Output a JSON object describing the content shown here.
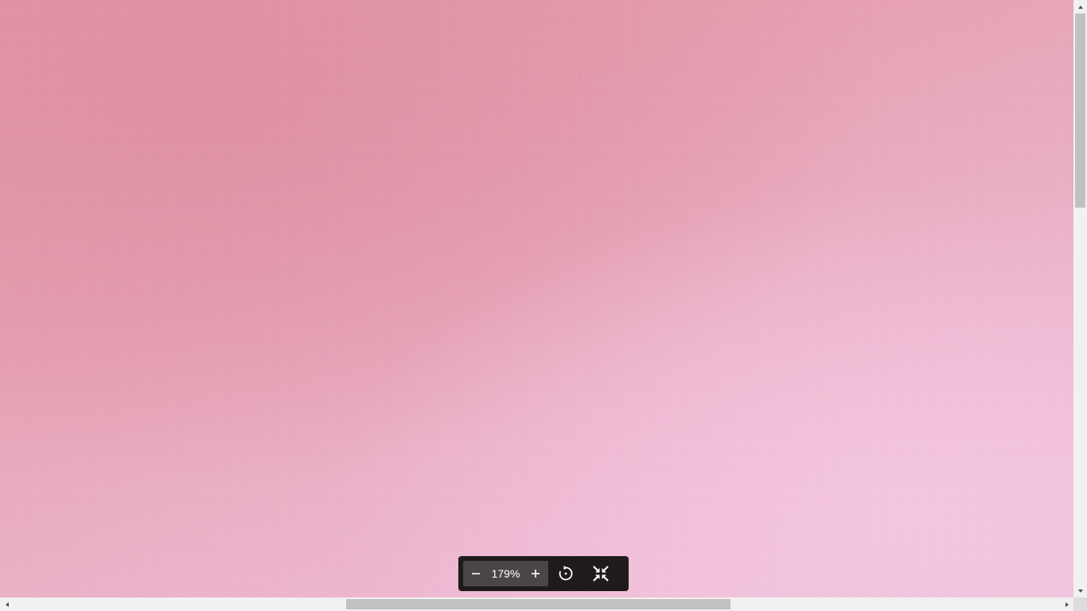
{
  "viewer": {
    "zoom_value": "179%",
    "zoom_out_label": "−",
    "zoom_in_label": "+"
  },
  "icons": {
    "zoom_out": "minus-icon",
    "zoom_in": "plus-icon",
    "rotate": "rotate-icon",
    "fit": "exit-fullscreen-icon"
  },
  "colors": {
    "toolbar_bg": "#1f1b1d",
    "zoom_group_bg": "#4a4648",
    "scrollbar_track": "#f1f1f1",
    "scrollbar_thumb": "#c1c1c1"
  }
}
